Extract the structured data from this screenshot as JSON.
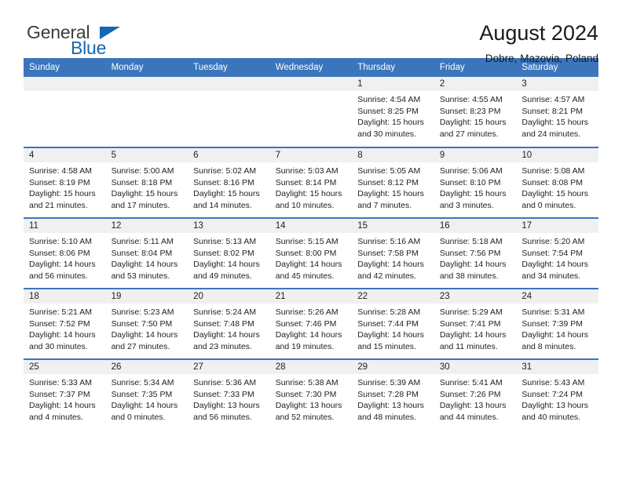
{
  "brand": {
    "name_part1": "General",
    "name_part2": "Blue",
    "accent_color": "#1268b3"
  },
  "header": {
    "title": "August 2024",
    "subtitle": "Dobre, Mazovia, Poland"
  },
  "calendar": {
    "header_background": "#3b76bc",
    "header_text_color": "#ffffff",
    "daynum_band_color": "#f0f0f0",
    "weekdays": [
      "Sunday",
      "Monday",
      "Tuesday",
      "Wednesday",
      "Thursday",
      "Friday",
      "Saturday"
    ],
    "weeks": [
      [
        {
          "empty": true
        },
        {
          "empty": true
        },
        {
          "empty": true
        },
        {
          "empty": true
        },
        {
          "day": "1",
          "sunrise": "Sunrise: 4:54 AM",
          "sunset": "Sunset: 8:25 PM",
          "daylight": "Daylight: 15 hours and 30 minutes."
        },
        {
          "day": "2",
          "sunrise": "Sunrise: 4:55 AM",
          "sunset": "Sunset: 8:23 PM",
          "daylight": "Daylight: 15 hours and 27 minutes."
        },
        {
          "day": "3",
          "sunrise": "Sunrise: 4:57 AM",
          "sunset": "Sunset: 8:21 PM",
          "daylight": "Daylight: 15 hours and 24 minutes."
        }
      ],
      [
        {
          "day": "4",
          "sunrise": "Sunrise: 4:58 AM",
          "sunset": "Sunset: 8:19 PM",
          "daylight": "Daylight: 15 hours and 21 minutes."
        },
        {
          "day": "5",
          "sunrise": "Sunrise: 5:00 AM",
          "sunset": "Sunset: 8:18 PM",
          "daylight": "Daylight: 15 hours and 17 minutes."
        },
        {
          "day": "6",
          "sunrise": "Sunrise: 5:02 AM",
          "sunset": "Sunset: 8:16 PM",
          "daylight": "Daylight: 15 hours and 14 minutes."
        },
        {
          "day": "7",
          "sunrise": "Sunrise: 5:03 AM",
          "sunset": "Sunset: 8:14 PM",
          "daylight": "Daylight: 15 hours and 10 minutes."
        },
        {
          "day": "8",
          "sunrise": "Sunrise: 5:05 AM",
          "sunset": "Sunset: 8:12 PM",
          "daylight": "Daylight: 15 hours and 7 minutes."
        },
        {
          "day": "9",
          "sunrise": "Sunrise: 5:06 AM",
          "sunset": "Sunset: 8:10 PM",
          "daylight": "Daylight: 15 hours and 3 minutes."
        },
        {
          "day": "10",
          "sunrise": "Sunrise: 5:08 AM",
          "sunset": "Sunset: 8:08 PM",
          "daylight": "Daylight: 15 hours and 0 minutes."
        }
      ],
      [
        {
          "day": "11",
          "sunrise": "Sunrise: 5:10 AM",
          "sunset": "Sunset: 8:06 PM",
          "daylight": "Daylight: 14 hours and 56 minutes."
        },
        {
          "day": "12",
          "sunrise": "Sunrise: 5:11 AM",
          "sunset": "Sunset: 8:04 PM",
          "daylight": "Daylight: 14 hours and 53 minutes."
        },
        {
          "day": "13",
          "sunrise": "Sunrise: 5:13 AM",
          "sunset": "Sunset: 8:02 PM",
          "daylight": "Daylight: 14 hours and 49 minutes."
        },
        {
          "day": "14",
          "sunrise": "Sunrise: 5:15 AM",
          "sunset": "Sunset: 8:00 PM",
          "daylight": "Daylight: 14 hours and 45 minutes."
        },
        {
          "day": "15",
          "sunrise": "Sunrise: 5:16 AM",
          "sunset": "Sunset: 7:58 PM",
          "daylight": "Daylight: 14 hours and 42 minutes."
        },
        {
          "day": "16",
          "sunrise": "Sunrise: 5:18 AM",
          "sunset": "Sunset: 7:56 PM",
          "daylight": "Daylight: 14 hours and 38 minutes."
        },
        {
          "day": "17",
          "sunrise": "Sunrise: 5:20 AM",
          "sunset": "Sunset: 7:54 PM",
          "daylight": "Daylight: 14 hours and 34 minutes."
        }
      ],
      [
        {
          "day": "18",
          "sunrise": "Sunrise: 5:21 AM",
          "sunset": "Sunset: 7:52 PM",
          "daylight": "Daylight: 14 hours and 30 minutes."
        },
        {
          "day": "19",
          "sunrise": "Sunrise: 5:23 AM",
          "sunset": "Sunset: 7:50 PM",
          "daylight": "Daylight: 14 hours and 27 minutes."
        },
        {
          "day": "20",
          "sunrise": "Sunrise: 5:24 AM",
          "sunset": "Sunset: 7:48 PM",
          "daylight": "Daylight: 14 hours and 23 minutes."
        },
        {
          "day": "21",
          "sunrise": "Sunrise: 5:26 AM",
          "sunset": "Sunset: 7:46 PM",
          "daylight": "Daylight: 14 hours and 19 minutes."
        },
        {
          "day": "22",
          "sunrise": "Sunrise: 5:28 AM",
          "sunset": "Sunset: 7:44 PM",
          "daylight": "Daylight: 14 hours and 15 minutes."
        },
        {
          "day": "23",
          "sunrise": "Sunrise: 5:29 AM",
          "sunset": "Sunset: 7:41 PM",
          "daylight": "Daylight: 14 hours and 11 minutes."
        },
        {
          "day": "24",
          "sunrise": "Sunrise: 5:31 AM",
          "sunset": "Sunset: 7:39 PM",
          "daylight": "Daylight: 14 hours and 8 minutes."
        }
      ],
      [
        {
          "day": "25",
          "sunrise": "Sunrise: 5:33 AM",
          "sunset": "Sunset: 7:37 PM",
          "daylight": "Daylight: 14 hours and 4 minutes."
        },
        {
          "day": "26",
          "sunrise": "Sunrise: 5:34 AM",
          "sunset": "Sunset: 7:35 PM",
          "daylight": "Daylight: 14 hours and 0 minutes."
        },
        {
          "day": "27",
          "sunrise": "Sunrise: 5:36 AM",
          "sunset": "Sunset: 7:33 PM",
          "daylight": "Daylight: 13 hours and 56 minutes."
        },
        {
          "day": "28",
          "sunrise": "Sunrise: 5:38 AM",
          "sunset": "Sunset: 7:30 PM",
          "daylight": "Daylight: 13 hours and 52 minutes."
        },
        {
          "day": "29",
          "sunrise": "Sunrise: 5:39 AM",
          "sunset": "Sunset: 7:28 PM",
          "daylight": "Daylight: 13 hours and 48 minutes."
        },
        {
          "day": "30",
          "sunrise": "Sunrise: 5:41 AM",
          "sunset": "Sunset: 7:26 PM",
          "daylight": "Daylight: 13 hours and 44 minutes."
        },
        {
          "day": "31",
          "sunrise": "Sunrise: 5:43 AM",
          "sunset": "Sunset: 7:24 PM",
          "daylight": "Daylight: 13 hours and 40 minutes."
        }
      ]
    ]
  }
}
